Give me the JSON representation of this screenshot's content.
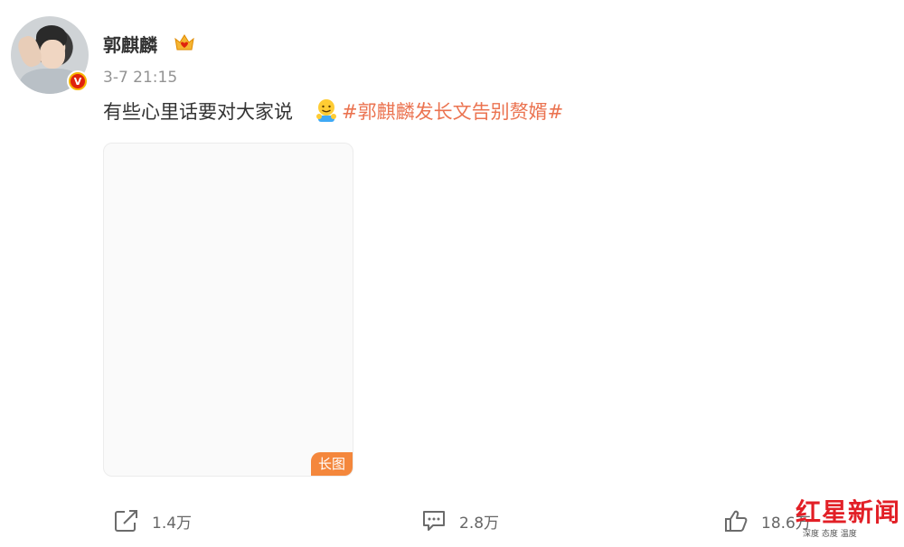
{
  "post": {
    "author": "郭麒麟",
    "time": "3-7 21:15",
    "text": "有些心里话要对大家说",
    "hashtag": "#郭麒麟发长文告别赘婿#",
    "image_tag": "长图"
  },
  "actions": {
    "share_count": "1.4万",
    "comment_count": "2.8万",
    "like_count": "18.6万"
  },
  "watermark": {
    "title": "红星新闻",
    "subtitle": "深度 态度 温度"
  },
  "colors": {
    "hashtag": "#eb7350",
    "long_tag_bg": "#f4873c",
    "verified": "#e0230d"
  },
  "icons": [
    "verified-badge-icon",
    "crown-icon",
    "hug-emoji-icon",
    "share-icon",
    "comment-icon",
    "like-icon"
  ]
}
